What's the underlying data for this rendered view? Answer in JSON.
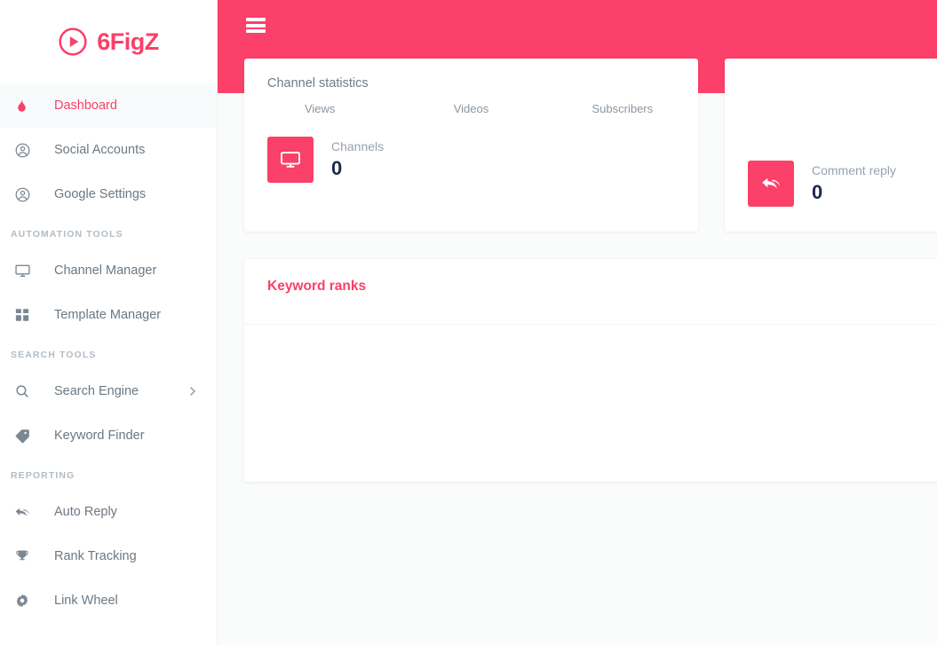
{
  "brand": {
    "name": "6FigZ",
    "logo_icon": "play-circle-icon"
  },
  "topbar": {
    "menu_icon": "hamburger-menu-icon",
    "accent_color": "#fb4069"
  },
  "sidebar": {
    "groups": [
      {
        "label": "",
        "items": [
          {
            "label": "Dashboard",
            "icon": "flame-icon",
            "active": true,
            "chevron": false
          },
          {
            "label": "Social Accounts",
            "icon": "user-circle-icon",
            "active": false,
            "chevron": false
          },
          {
            "label": "Google Settings",
            "icon": "user-circle-icon",
            "active": false,
            "chevron": false
          }
        ]
      },
      {
        "label": "AUTOMATION TOOLS",
        "items": [
          {
            "label": "Channel Manager",
            "icon": "monitor-icon",
            "active": false,
            "chevron": false
          },
          {
            "label": "Template Manager",
            "icon": "grid-icon",
            "active": false,
            "chevron": false
          }
        ]
      },
      {
        "label": "SEARCH TOOLS",
        "items": [
          {
            "label": "Search Engine",
            "icon": "search-icon",
            "active": false,
            "chevron": true
          },
          {
            "label": "Keyword Finder",
            "icon": "tag-icon",
            "active": false,
            "chevron": false
          }
        ]
      },
      {
        "label": "REPORTING",
        "items": [
          {
            "label": "Auto Reply",
            "icon": "reply-all-icon",
            "active": false,
            "chevron": false
          },
          {
            "label": "Rank Tracking",
            "icon": "trophy-icon",
            "active": false,
            "chevron": false
          },
          {
            "label": "Link Wheel",
            "icon": "gear-icon",
            "active": false,
            "chevron": false
          }
        ]
      }
    ]
  },
  "main": {
    "channel_statistics": {
      "title": "Channel statistics",
      "columns": [
        "Views",
        "Videos",
        "Subscribers"
      ],
      "tile": {
        "icon": "monitor-icon",
        "label": "Channels",
        "value": "0"
      }
    },
    "comment_reply": {
      "tile": {
        "icon": "reply-all-icon",
        "label": "Comment reply",
        "value": "0"
      }
    },
    "keyword_ranks": {
      "title": "Keyword ranks"
    }
  }
}
